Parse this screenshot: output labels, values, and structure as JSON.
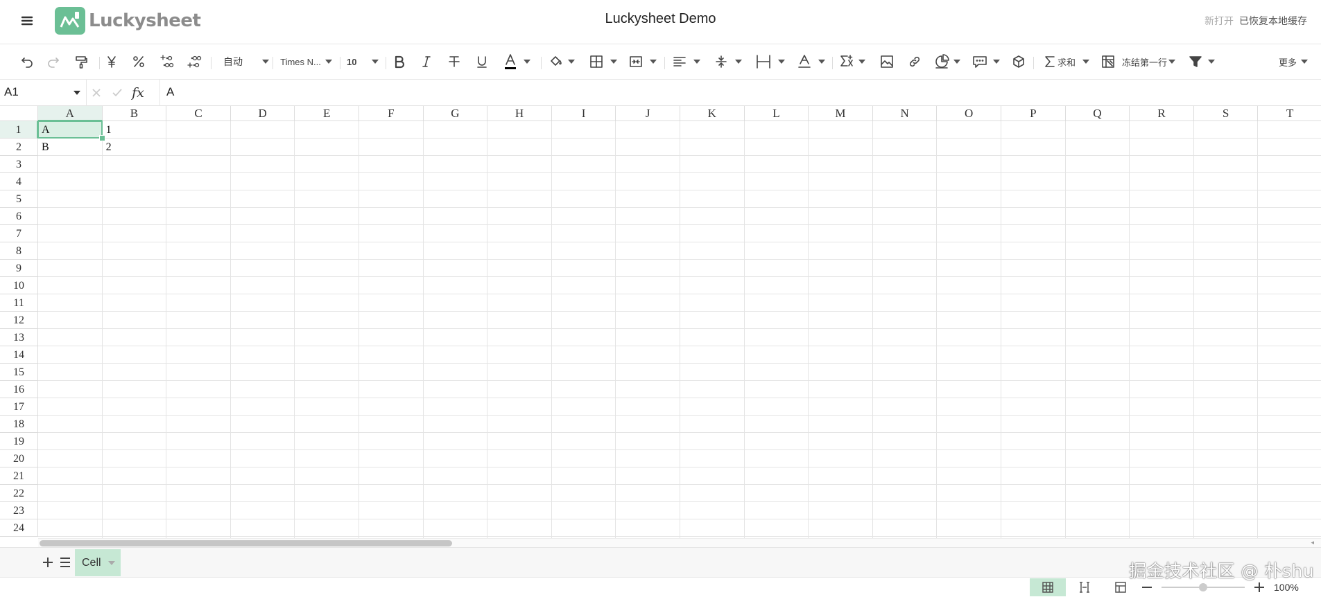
{
  "header": {
    "app_name": "Luckysheet",
    "doc_title": "Luckysheet Demo",
    "status_reopen": "新打开",
    "status_cache": "已恢复本地缓存",
    "brand_color": "#6bbf95"
  },
  "toolbar": {
    "format_label": "自动",
    "font_family": "Times N...",
    "font_size": "10",
    "sum_label": "求和",
    "freeze_label": "冻结第一行",
    "more_label": "更多",
    "icons": [
      "undo-icon",
      "redo-icon",
      "paint-format-icon",
      "currency-icon",
      "percent-icon",
      "decrease-decimal-icon",
      "increase-decimal-icon",
      "bold-icon",
      "italic-icon",
      "strikethrough-icon",
      "underline-icon",
      "text-color-icon",
      "fill-color-icon",
      "border-icon",
      "merge-icon",
      "horizontal-align-icon",
      "vertical-align-icon",
      "text-wrap-icon",
      "text-rotate-icon",
      "function-icon",
      "image-icon",
      "link-icon",
      "chart-icon",
      "comment-icon",
      "pivot-icon",
      "sum-icon",
      "freeze-icon",
      "filter-icon"
    ]
  },
  "formula_bar": {
    "cell_ref": "A1",
    "fx_label": "fx",
    "content": "A"
  },
  "grid": {
    "columns": [
      "A",
      "B",
      "C",
      "D",
      "E",
      "F",
      "G",
      "H",
      "I",
      "J",
      "K",
      "L",
      "M",
      "N",
      "O",
      "P",
      "Q",
      "R",
      "S",
      "T"
    ],
    "rows": [
      "1",
      "2",
      "3",
      "4",
      "5",
      "6",
      "7",
      "8",
      "9",
      "10",
      "11",
      "12",
      "13",
      "14",
      "15",
      "16",
      "17",
      "18",
      "19",
      "20",
      "21",
      "22",
      "23",
      "24"
    ],
    "cells": [
      {
        "ref": "A1",
        "value": "A"
      },
      {
        "ref": "B1",
        "value": "1"
      },
      {
        "ref": "A2",
        "value": "B"
      },
      {
        "ref": "B2",
        "value": "2"
      }
    ],
    "selected": "A1"
  },
  "sheets": {
    "tabs": [
      "Cell"
    ],
    "active": "Cell"
  },
  "status_bar": {
    "zoom": "100%"
  },
  "watermark": "掘金技术社区 @ 朴shu"
}
